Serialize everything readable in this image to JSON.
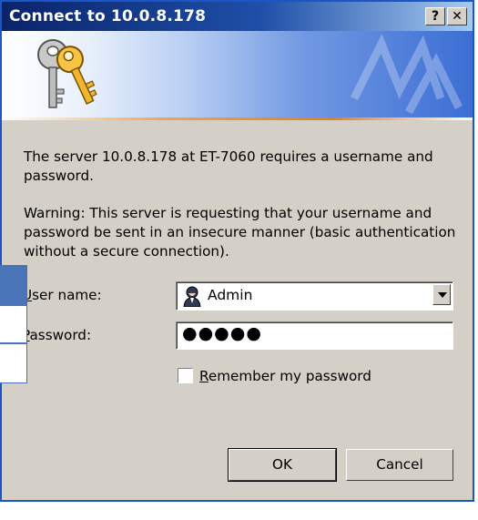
{
  "window": {
    "title": "Connect to 10.0.8.178",
    "help_label": "?",
    "close_label": "✕"
  },
  "message": {
    "line1": "The server 10.0.8.178 at ET-7060 requires a username and",
    "line2": "password.",
    "warning1": "Warning: This server is requesting that your username and",
    "warning2": "password be sent in an insecure manner (basic authentication",
    "warning3": "without a secure connection)."
  },
  "form": {
    "username_label_first": "U",
    "username_label_rest": "ser name:",
    "username_value": "Admin",
    "password_label_first": "P",
    "password_label_rest": "assword:",
    "password_value": "●●●●●",
    "remember_first": "R",
    "remember_rest": "emember my password",
    "remember_checked": false
  },
  "buttons": {
    "ok": "OK",
    "cancel": "Cancel"
  },
  "colors": {
    "title_bar": "#0a246a",
    "dialog_face": "#d4d0c8",
    "overlay_accent": "#4a74b8"
  },
  "icons": {
    "banner": "keys-icon",
    "username": "user-icon"
  }
}
